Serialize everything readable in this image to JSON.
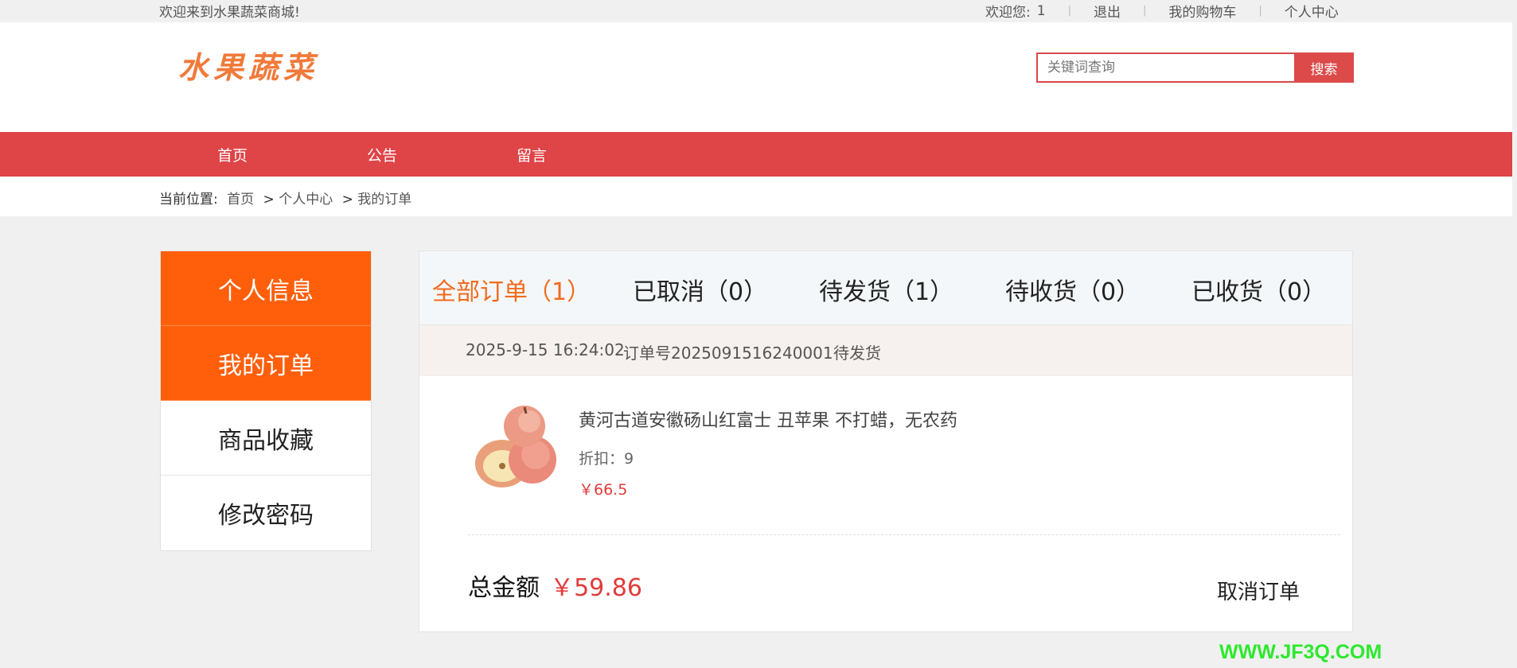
{
  "topbar": {
    "welcome": "欢迎来到水果蔬菜商城!",
    "user_label": "欢迎您:",
    "user_name": "1",
    "logout": "退出",
    "cart": "我的购物车",
    "user_center": "个人中心"
  },
  "header": {
    "logo_text": "水果蔬菜",
    "search_placeholder": "关键词查询",
    "search_button": "搜索"
  },
  "nav": {
    "items": [
      "首页",
      "公告",
      "留言"
    ]
  },
  "breadcrumb": {
    "label": "当前位置:",
    "home": "首页",
    "sep1": ">",
    "center": "个人中心",
    "sep2": ">",
    "current": "我的订单"
  },
  "sidebar": {
    "items": [
      "个人信息",
      "我的订单",
      "商品收藏",
      "修改密码"
    ]
  },
  "tabs": [
    "全部订单（1）",
    "已取消（0）",
    "待发货（1）",
    "待收货（0）",
    "已收货（0）"
  ],
  "order": {
    "datetime": "2025-9-15 16:24:02",
    "number": "订单号2025091516240001",
    "status": "待发货",
    "product_name": "黄河古道安徽砀山红富士 丑苹果 不打蜡，无农药",
    "discount": "折扣：9",
    "price": "￥66.5",
    "total_label": "总金额",
    "total_value": "￥59.86",
    "cancel_label": "取消订单"
  },
  "watermark": "WWW.JF3Q.COM",
  "colors": {
    "nav_red": "#df4447",
    "sidebar_active": "#ff5f0a",
    "tab_active": "#f26a1b",
    "price_red": "#e03a3a"
  }
}
